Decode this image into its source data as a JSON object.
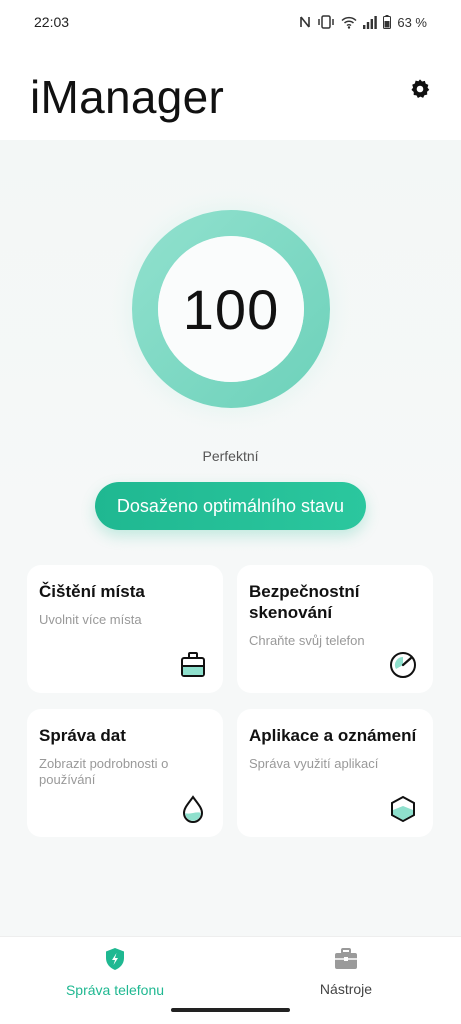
{
  "status_bar": {
    "time": "22:03",
    "battery": "63 %",
    "icons": [
      "nfc-icon",
      "vibrate-icon",
      "wifi-icon",
      "signal-icon",
      "battery-icon"
    ]
  },
  "header": {
    "title": "iManager",
    "settings_icon": "gear-icon"
  },
  "score": {
    "value": "100",
    "label": "Perfektní",
    "ring_color": "#7ed9c4"
  },
  "optimal_button": {
    "label": "Dosaženo optimálního stavu",
    "color": "#22bd95"
  },
  "cards": [
    {
      "title": "Čištění místa",
      "subtitle": "Uvolnit více místa",
      "icon": "cleaner-icon"
    },
    {
      "title": "Bezpečnostní skenování",
      "subtitle": "Chraňte svůj telefon",
      "icon": "scan-gauge-icon"
    },
    {
      "title": "Správa dat",
      "subtitle": "Zobrazit podrobnosti o používání",
      "icon": "water-drop-icon"
    },
    {
      "title": "Aplikace a oznámení",
      "subtitle": "Správa využití aplikací",
      "icon": "hexagon-icon"
    }
  ],
  "bottom_nav": [
    {
      "label": "Správa telefonu",
      "icon": "shield-bolt-icon",
      "active": true
    },
    {
      "label": "Nástroje",
      "icon": "toolbox-icon",
      "active": false
    }
  ],
  "colors": {
    "accent": "#1fb891",
    "background": "#f6f8f8"
  }
}
